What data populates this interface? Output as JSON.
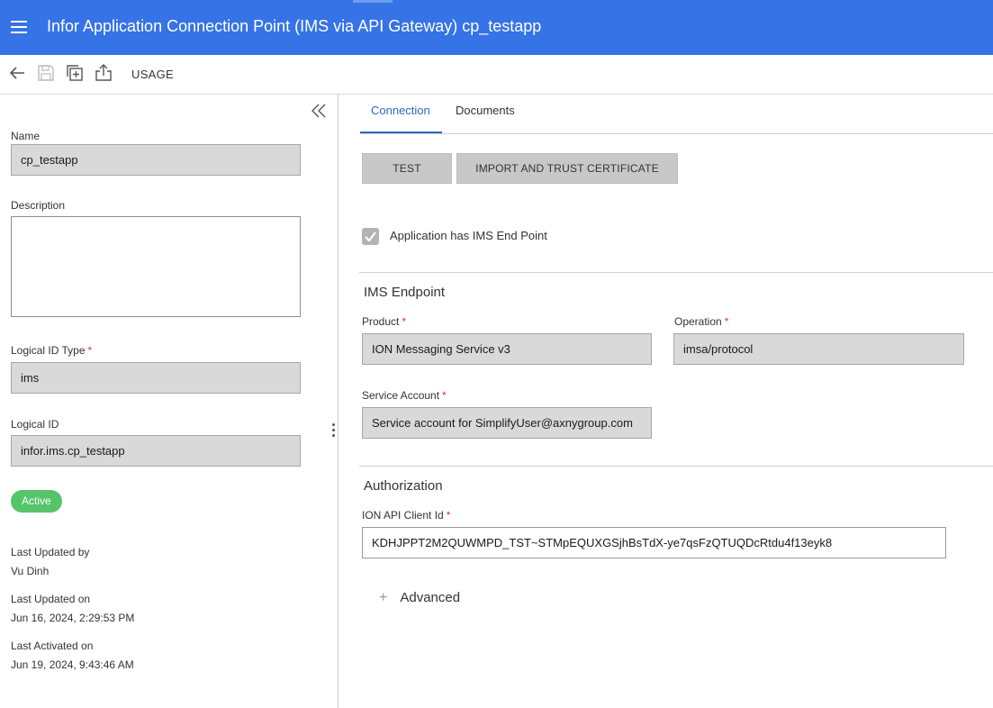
{
  "header": {
    "title": "Infor Application Connection Point (IMS via API Gateway) cp_testapp",
    "color": "#3573e6"
  },
  "toolbar": {
    "icons": [
      "back-arrow-icon",
      "save-icon",
      "duplicate-icon",
      "export-icon"
    ],
    "usage_label": "USAGE"
  },
  "left": {
    "name_label": "Name",
    "name_value": "cp_testapp",
    "description_label": "Description",
    "description_value": "",
    "logical_id_type_label": "Logical ID Type",
    "logical_id_type_value": "ims",
    "logical_id_label": "Logical ID",
    "logical_id_value": "infor.ims.cp_testapp",
    "status": "Active",
    "last_updated_by_label": "Last Updated by",
    "last_updated_by_value": "Vu Dinh",
    "last_updated_on_label": "Last Updated on",
    "last_updated_on_value": "Jun 16, 2024, 2:29:53 PM",
    "last_activated_on_label": "Last Activated on",
    "last_activated_on_value": "Jun 19, 2024, 9:43:46 AM"
  },
  "tabs": [
    "Connection",
    "Documents"
  ],
  "connection": {
    "test_button": "TEST",
    "import_button": "IMPORT AND TRUST CERTIFICATE",
    "checkbox_label": "Application has IMS End Point",
    "checkbox_checked": true,
    "ims_section_title": "IMS Endpoint",
    "product_label": "Product",
    "product_value": "ION Messaging Service v3",
    "operation_label": "Operation",
    "operation_value": "imsa/protocol",
    "service_account_label": "Service Account",
    "service_account_value": "Service account for SimplifyUser@axnygroup.com",
    "auth_section_title": "Authorization",
    "client_id_label": "ION API Client Id",
    "client_id_value": "KDHJPPT2M2QUWMPD_TST~STMpEQUXGSjhBsTdX-ye7qsFzQTUQDcRtdu4f13eyk8",
    "advanced_label": "Advanced",
    "advanced_icon": "+"
  }
}
